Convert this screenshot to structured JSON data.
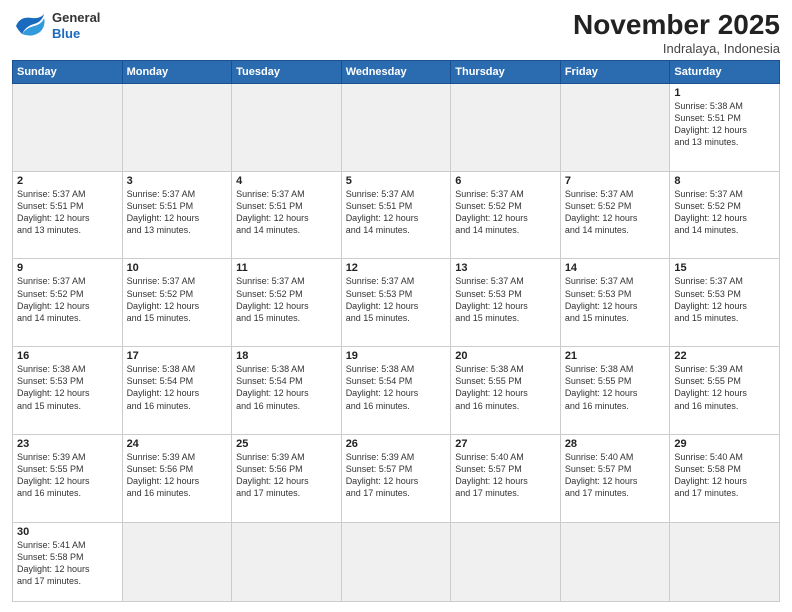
{
  "logo": {
    "line1": "General",
    "line2": "Blue"
  },
  "title": "November 2025",
  "location": "Indralaya, Indonesia",
  "days_header": [
    "Sunday",
    "Monday",
    "Tuesday",
    "Wednesday",
    "Thursday",
    "Friday",
    "Saturday"
  ],
  "weeks": [
    [
      {
        "day": "",
        "info": ""
      },
      {
        "day": "",
        "info": ""
      },
      {
        "day": "",
        "info": ""
      },
      {
        "day": "",
        "info": ""
      },
      {
        "day": "",
        "info": ""
      },
      {
        "day": "",
        "info": ""
      },
      {
        "day": "1",
        "info": "Sunrise: 5:38 AM\nSunset: 5:51 PM\nDaylight: 12 hours\nand 13 minutes."
      }
    ],
    [
      {
        "day": "2",
        "info": "Sunrise: 5:37 AM\nSunset: 5:51 PM\nDaylight: 12 hours\nand 13 minutes."
      },
      {
        "day": "3",
        "info": "Sunrise: 5:37 AM\nSunset: 5:51 PM\nDaylight: 12 hours\nand 13 minutes."
      },
      {
        "day": "4",
        "info": "Sunrise: 5:37 AM\nSunset: 5:51 PM\nDaylight: 12 hours\nand 14 minutes."
      },
      {
        "day": "5",
        "info": "Sunrise: 5:37 AM\nSunset: 5:51 PM\nDaylight: 12 hours\nand 14 minutes."
      },
      {
        "day": "6",
        "info": "Sunrise: 5:37 AM\nSunset: 5:52 PM\nDaylight: 12 hours\nand 14 minutes."
      },
      {
        "day": "7",
        "info": "Sunrise: 5:37 AM\nSunset: 5:52 PM\nDaylight: 12 hours\nand 14 minutes."
      },
      {
        "day": "8",
        "info": "Sunrise: 5:37 AM\nSunset: 5:52 PM\nDaylight: 12 hours\nand 14 minutes."
      }
    ],
    [
      {
        "day": "9",
        "info": "Sunrise: 5:37 AM\nSunset: 5:52 PM\nDaylight: 12 hours\nand 14 minutes."
      },
      {
        "day": "10",
        "info": "Sunrise: 5:37 AM\nSunset: 5:52 PM\nDaylight: 12 hours\nand 15 minutes."
      },
      {
        "day": "11",
        "info": "Sunrise: 5:37 AM\nSunset: 5:52 PM\nDaylight: 12 hours\nand 15 minutes."
      },
      {
        "day": "12",
        "info": "Sunrise: 5:37 AM\nSunset: 5:53 PM\nDaylight: 12 hours\nand 15 minutes."
      },
      {
        "day": "13",
        "info": "Sunrise: 5:37 AM\nSunset: 5:53 PM\nDaylight: 12 hours\nand 15 minutes."
      },
      {
        "day": "14",
        "info": "Sunrise: 5:37 AM\nSunset: 5:53 PM\nDaylight: 12 hours\nand 15 minutes."
      },
      {
        "day": "15",
        "info": "Sunrise: 5:37 AM\nSunset: 5:53 PM\nDaylight: 12 hours\nand 15 minutes."
      }
    ],
    [
      {
        "day": "16",
        "info": "Sunrise: 5:38 AM\nSunset: 5:53 PM\nDaylight: 12 hours\nand 15 minutes."
      },
      {
        "day": "17",
        "info": "Sunrise: 5:38 AM\nSunset: 5:54 PM\nDaylight: 12 hours\nand 16 minutes."
      },
      {
        "day": "18",
        "info": "Sunrise: 5:38 AM\nSunset: 5:54 PM\nDaylight: 12 hours\nand 16 minutes."
      },
      {
        "day": "19",
        "info": "Sunrise: 5:38 AM\nSunset: 5:54 PM\nDaylight: 12 hours\nand 16 minutes."
      },
      {
        "day": "20",
        "info": "Sunrise: 5:38 AM\nSunset: 5:55 PM\nDaylight: 12 hours\nand 16 minutes."
      },
      {
        "day": "21",
        "info": "Sunrise: 5:38 AM\nSunset: 5:55 PM\nDaylight: 12 hours\nand 16 minutes."
      },
      {
        "day": "22",
        "info": "Sunrise: 5:39 AM\nSunset: 5:55 PM\nDaylight: 12 hours\nand 16 minutes."
      }
    ],
    [
      {
        "day": "23",
        "info": "Sunrise: 5:39 AM\nSunset: 5:55 PM\nDaylight: 12 hours\nand 16 minutes."
      },
      {
        "day": "24",
        "info": "Sunrise: 5:39 AM\nSunset: 5:56 PM\nDaylight: 12 hours\nand 16 minutes."
      },
      {
        "day": "25",
        "info": "Sunrise: 5:39 AM\nSunset: 5:56 PM\nDaylight: 12 hours\nand 17 minutes."
      },
      {
        "day": "26",
        "info": "Sunrise: 5:39 AM\nSunset: 5:57 PM\nDaylight: 12 hours\nand 17 minutes."
      },
      {
        "day": "27",
        "info": "Sunrise: 5:40 AM\nSunset: 5:57 PM\nDaylight: 12 hours\nand 17 minutes."
      },
      {
        "day": "28",
        "info": "Sunrise: 5:40 AM\nSunset: 5:57 PM\nDaylight: 12 hours\nand 17 minutes."
      },
      {
        "day": "29",
        "info": "Sunrise: 5:40 AM\nSunset: 5:58 PM\nDaylight: 12 hours\nand 17 minutes."
      }
    ],
    [
      {
        "day": "30",
        "info": "Sunrise: 5:41 AM\nSunset: 5:58 PM\nDaylight: 12 hours\nand 17 minutes."
      },
      {
        "day": "",
        "info": ""
      },
      {
        "day": "",
        "info": ""
      },
      {
        "day": "",
        "info": ""
      },
      {
        "day": "",
        "info": ""
      },
      {
        "day": "",
        "info": ""
      },
      {
        "day": "",
        "info": ""
      }
    ]
  ]
}
